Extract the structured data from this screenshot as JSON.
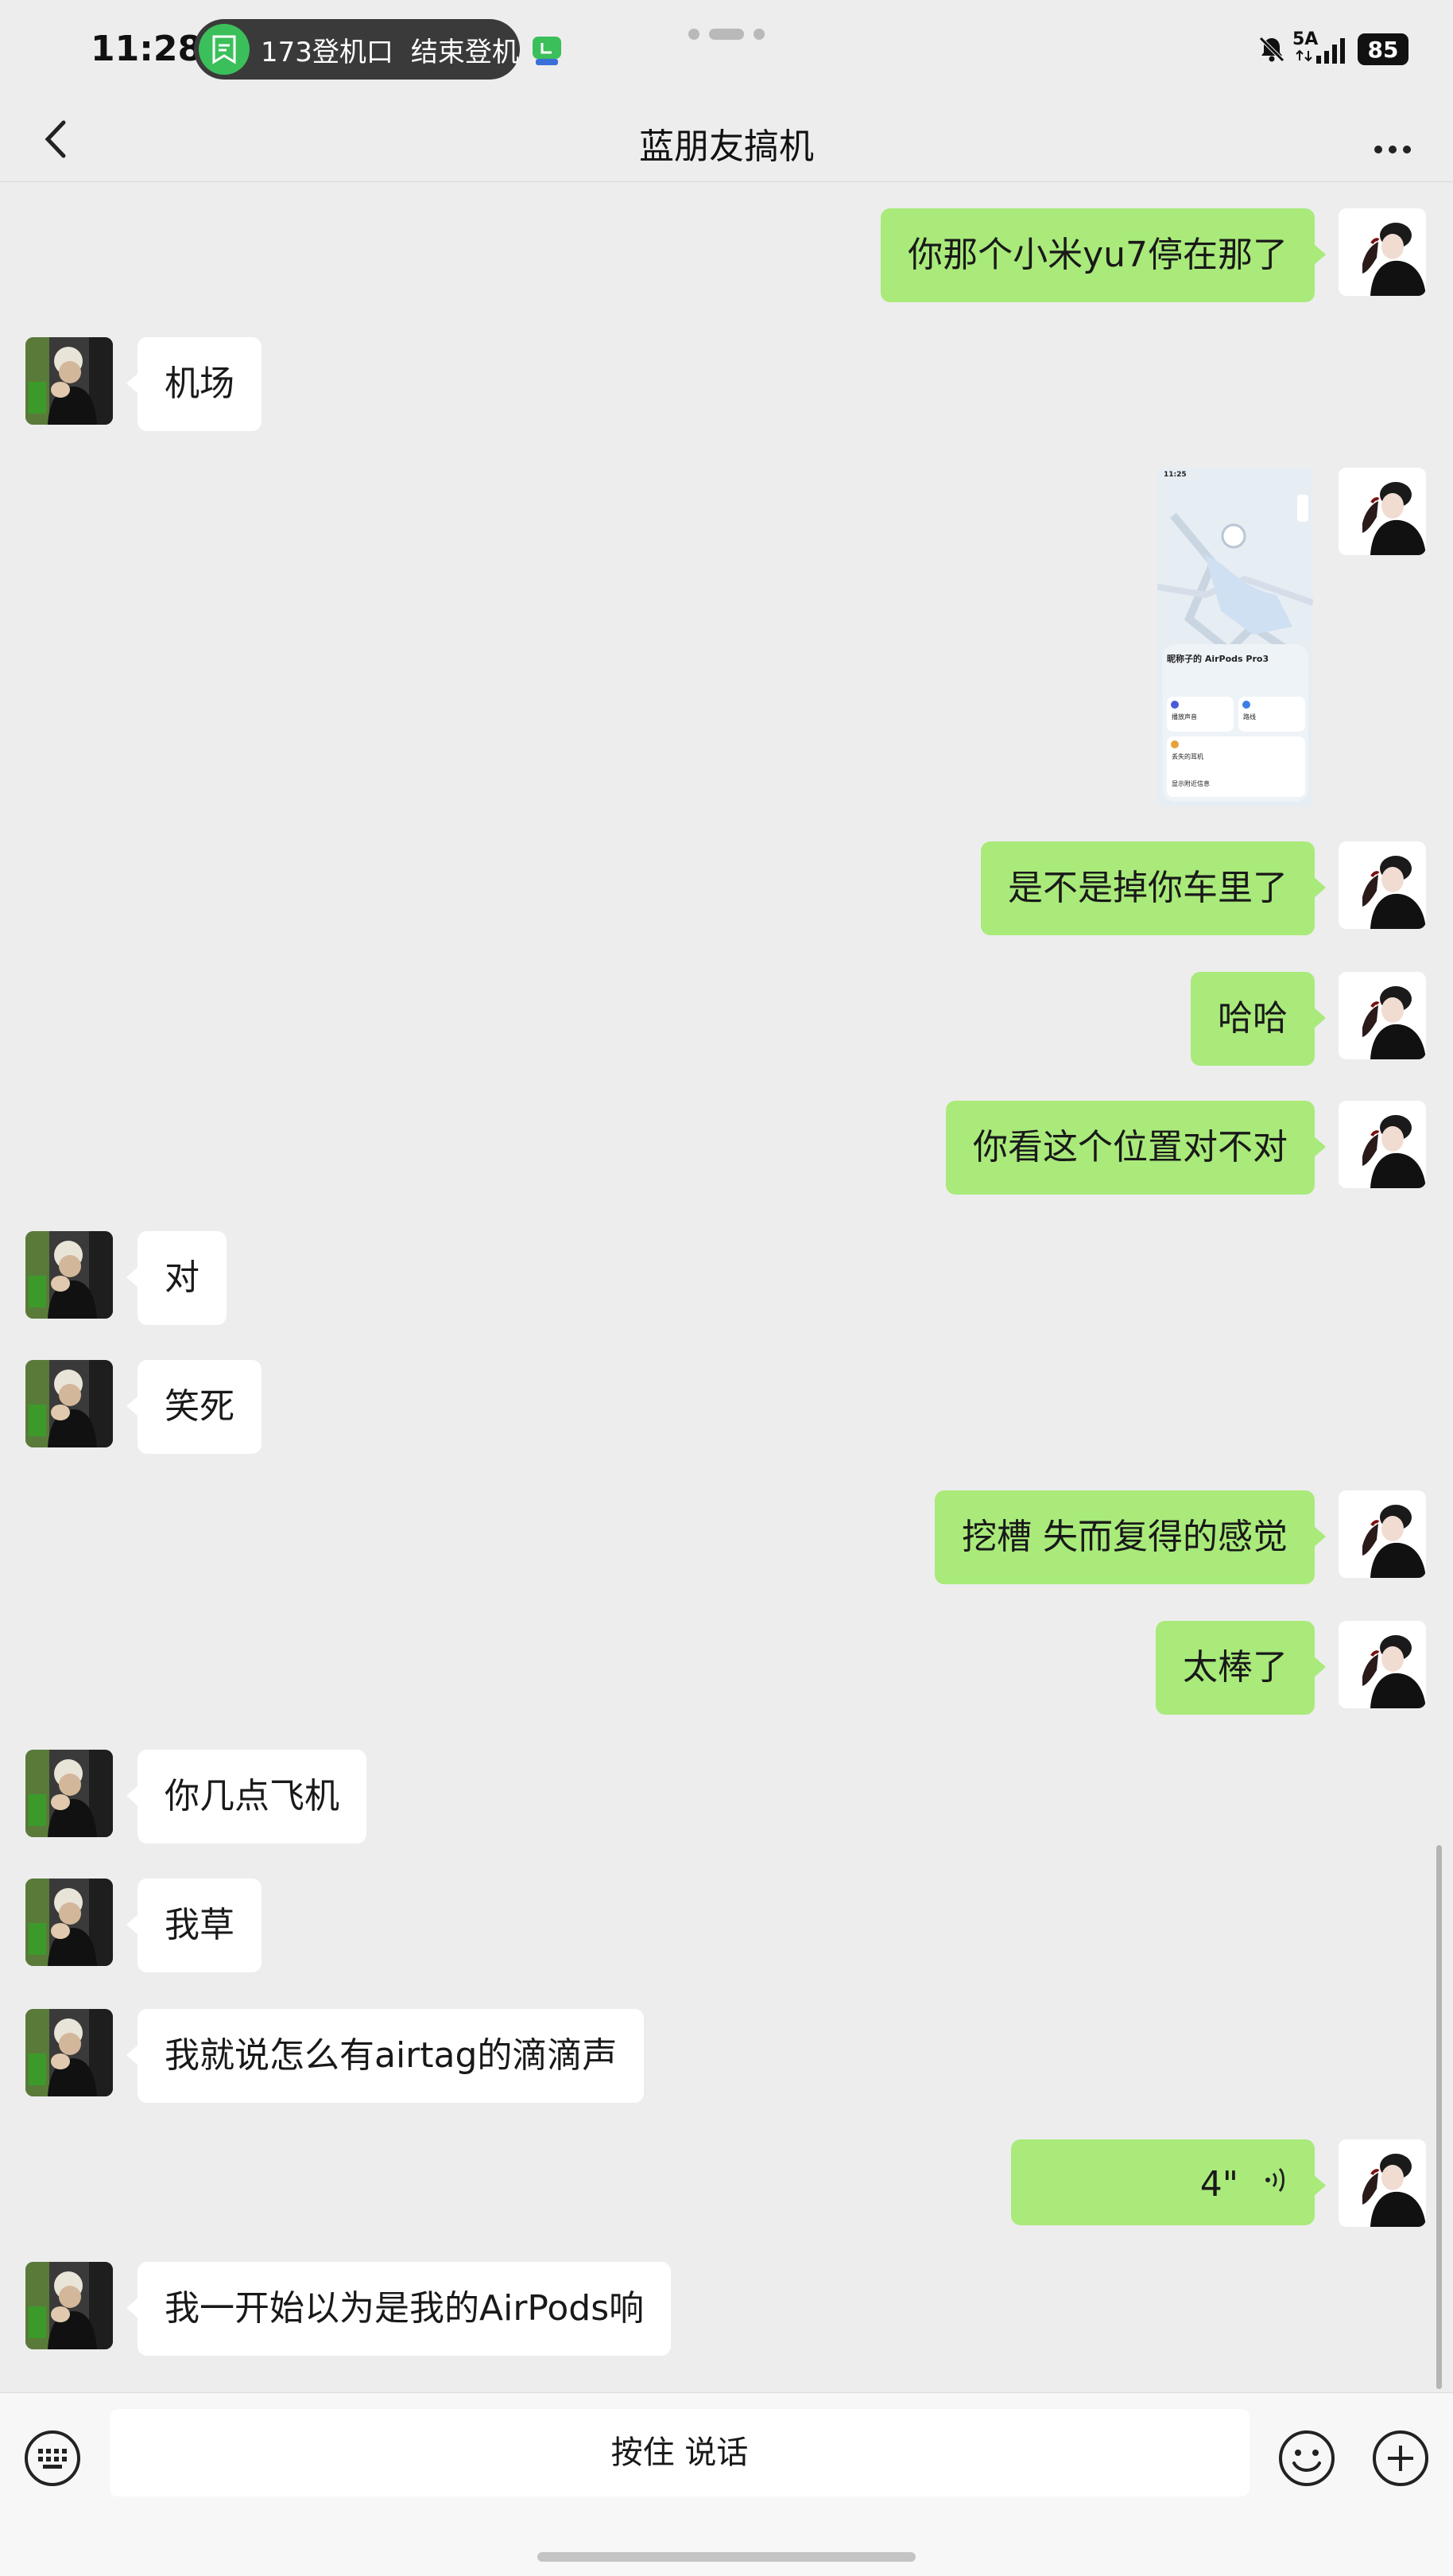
{
  "status_bar": {
    "time": "11:28",
    "flight_number": "173登机口",
    "flight_status": "结束登机",
    "network": "5A",
    "battery": "85"
  },
  "nav": {
    "title": "蓝朋友搞机",
    "back_icon": "chevron-left-icon",
    "more_icon": "more-dots-icon"
  },
  "messages": [
    {
      "from": "me",
      "text": "你那个小米yu7停在那了"
    },
    {
      "from": "them",
      "text": "机场"
    },
    {
      "from": "me",
      "type": "image",
      "image": {
        "time": "11:25",
        "title": "昵称子的 AirPods Pro3",
        "action_1": "播放声音",
        "action_2": "路线",
        "action_3": "丢失的耳机",
        "footer": "显示附近信息"
      }
    },
    {
      "from": "me",
      "text": "是不是掉你车里了"
    },
    {
      "from": "me",
      "text": "哈哈"
    },
    {
      "from": "me",
      "text": "你看这个位置对不对"
    },
    {
      "from": "them",
      "text": "对"
    },
    {
      "from": "them",
      "text": "笑死"
    },
    {
      "from": "me",
      "text": "挖槽 失而复得的感觉"
    },
    {
      "from": "me",
      "text": "太棒了"
    },
    {
      "from": "them",
      "text": "你几点飞机"
    },
    {
      "from": "them",
      "text": "我草"
    },
    {
      "from": "them",
      "text": "我就说怎么有airtag的滴滴声"
    },
    {
      "from": "me",
      "type": "voice",
      "duration": "4\""
    },
    {
      "from": "them",
      "text": "我一开始以为是我的AirPods响"
    }
  ],
  "input_bar": {
    "hold_to_talk": "按住 说话",
    "keyboard_icon": "keyboard-icon",
    "emoji_icon": "emoji-icon",
    "plus_icon": "plus-icon"
  }
}
